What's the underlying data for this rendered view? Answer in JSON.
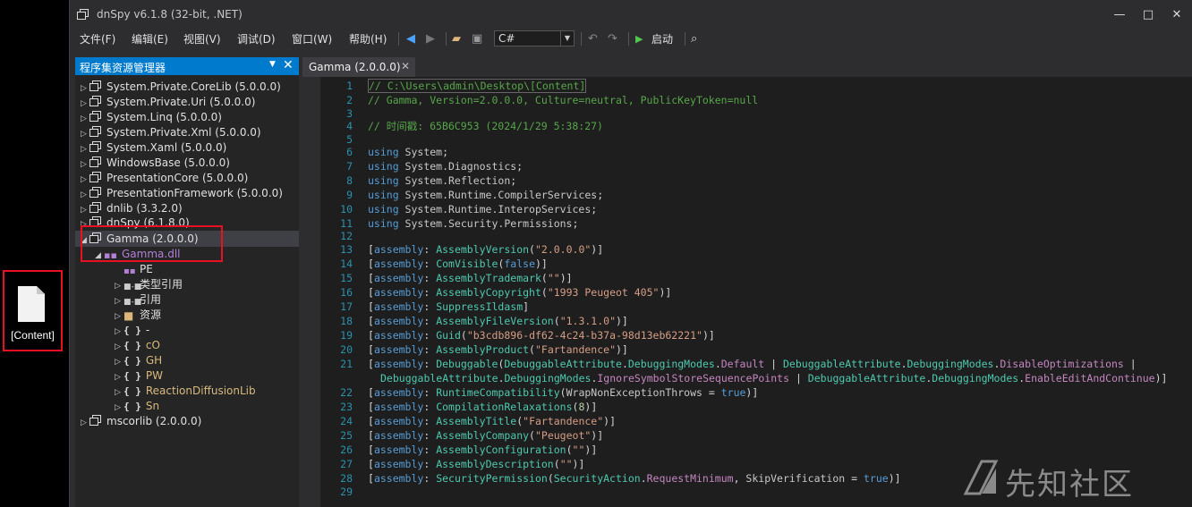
{
  "desktop": {
    "file_label": "[Content]"
  },
  "window": {
    "title": "dnSpy v6.1.8 (32-bit, .NET)",
    "controls": {
      "minimize": "—",
      "maximize": "□",
      "close": "✕"
    }
  },
  "menu": [
    "文件(F)",
    "编辑(E)",
    "视图(V)",
    "调试(D)",
    "窗口(W)",
    "帮助(H)"
  ],
  "toolbar": {
    "language": "C#",
    "start_label": "启动"
  },
  "explorer": {
    "title": "程序集资源管理器",
    "assemblies": [
      "System.Private.CoreLib (5.0.0.0)",
      "System.Private.Uri (5.0.0.0)",
      "System.Linq (5.0.0.0)",
      "System.Private.Xml (5.0.0.0)",
      "System.Xaml (5.0.0.0)",
      "WindowsBase (5.0.0.0)",
      "PresentationCore (5.0.0.0)",
      "PresentationFramework (5.0.0.0)",
      "dnlib (3.3.2.0)",
      "dnSpy (6.1.8.0)"
    ],
    "selected_assembly": "Gamma (2.0.0.0)",
    "module": "Gamma.dll",
    "children": [
      "PE",
      "类型引用",
      "引用",
      "资源"
    ],
    "namespaces": [
      "-",
      "cO",
      "GH",
      "PW",
      "ReactionDiffusionLib",
      "Sn"
    ],
    "last_assembly": "mscorlib (2.0.0.0)"
  },
  "editor": {
    "tab_label": "Gamma (2.0.0.0)",
    "line_numbers": [
      "1",
      "2",
      "3",
      "4",
      "5",
      "6",
      "7",
      "8",
      "9",
      "10",
      "11",
      "12",
      "13",
      "14",
      "15",
      "16",
      "17",
      "18",
      "19",
      "20",
      "21",
      "22",
      "23",
      "24",
      "25",
      "26",
      "27",
      "28",
      "29"
    ],
    "header_comments": [
      "// C:\\Users\\admin\\Desktop\\[Content]",
      "// Gamma, Version=2.0.0.0, Culture=neutral, PublicKeyToken=null",
      "// 时间戳: 65B6C953 (2024/1/29 5:38:27)"
    ],
    "usings": [
      "System",
      "System.Diagnostics",
      "System.Reflection",
      "System.Runtime.CompilerServices",
      "System.Runtime.InteropServices",
      "System.Security.Permissions"
    ],
    "attributes": {
      "version": "\"2.0.0.0\"",
      "com_visible": "false",
      "trademark": "\"\"",
      "copyright": "\"1993 Peugeot 405\"",
      "file_version": "\"1.3.1.0\"",
      "guid": "\"b3cdb896-df62-4c24-b37a-98d13eb62221\"",
      "product": "\"Fartandence\"",
      "relaxations": "8",
      "title": "\"Fartandence\"",
      "company": "\"Peugeot\"",
      "configuration": "\"\"",
      "description": "\"\""
    }
  },
  "watermark": "先知社区"
}
